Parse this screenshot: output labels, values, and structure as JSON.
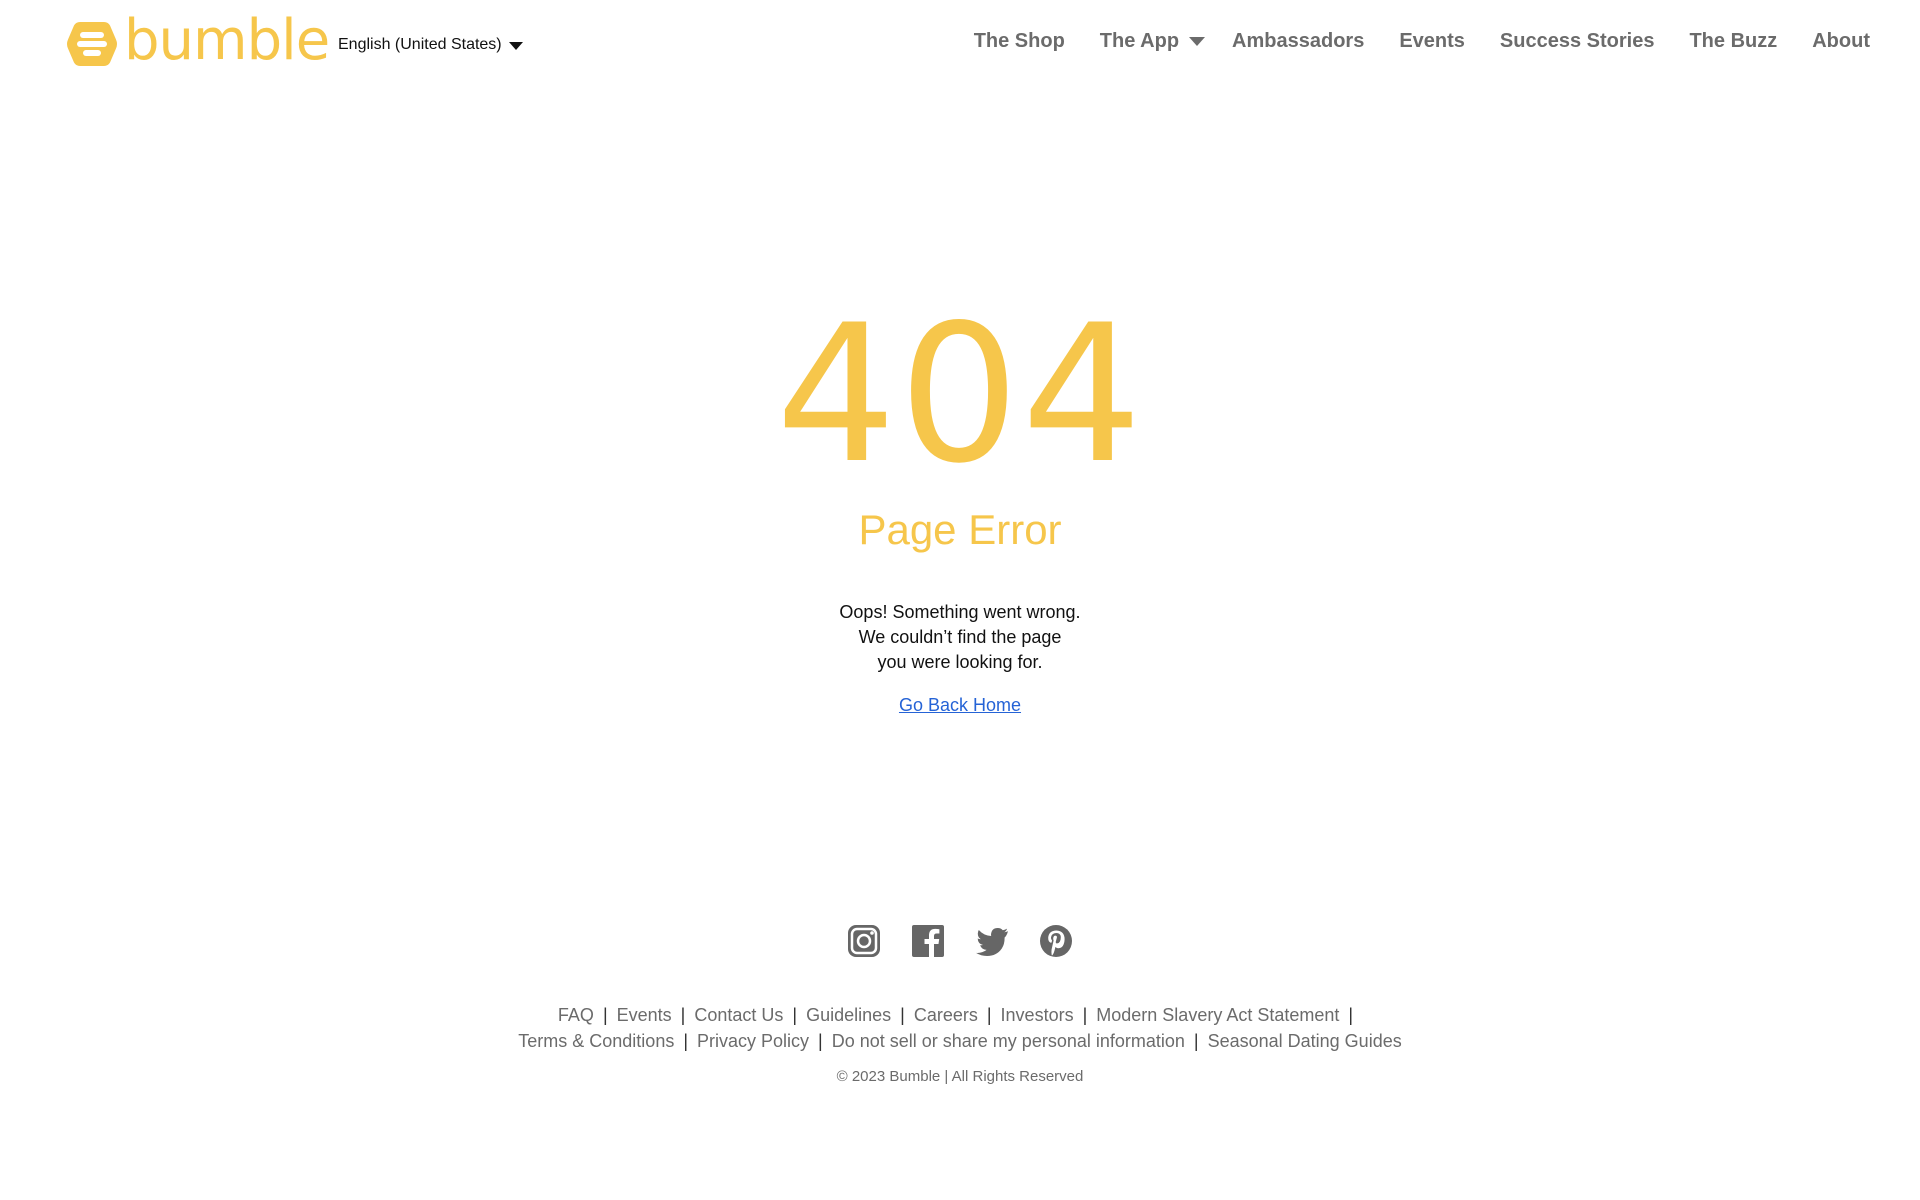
{
  "brand": {
    "name": "bumble",
    "color": "#F6C64B"
  },
  "language": {
    "selected": "English (United States)"
  },
  "nav": {
    "items": [
      {
        "label": "The Shop"
      },
      {
        "label": "The App",
        "has_dropdown": true
      },
      {
        "label": "Ambassadors"
      },
      {
        "label": "Events"
      },
      {
        "label": "Success Stories"
      },
      {
        "label": "The Buzz"
      },
      {
        "label": "About"
      }
    ]
  },
  "error": {
    "code": "404",
    "title": "Page Error",
    "message_lines": [
      "Oops! Something went wrong.",
      "We couldn’t find the page",
      "you were looking for."
    ],
    "home_link": "Go Back Home"
  },
  "social": {
    "icons": [
      "instagram-icon",
      "facebook-icon",
      "twitter-icon",
      "pinterest-icon"
    ],
    "icon_color": "#666666"
  },
  "footer": {
    "row1": [
      "FAQ",
      "Events",
      "Contact Us",
      "Guidelines",
      "Careers",
      "Investors",
      "Modern Slavery Act Statement"
    ],
    "row2": [
      "Terms & Conditions",
      "Privacy Policy",
      "Do not sell or share my personal information",
      "Seasonal Dating Guides"
    ],
    "separator": "|",
    "copyright": "© 2023 Bumble | All Rights Reserved"
  }
}
